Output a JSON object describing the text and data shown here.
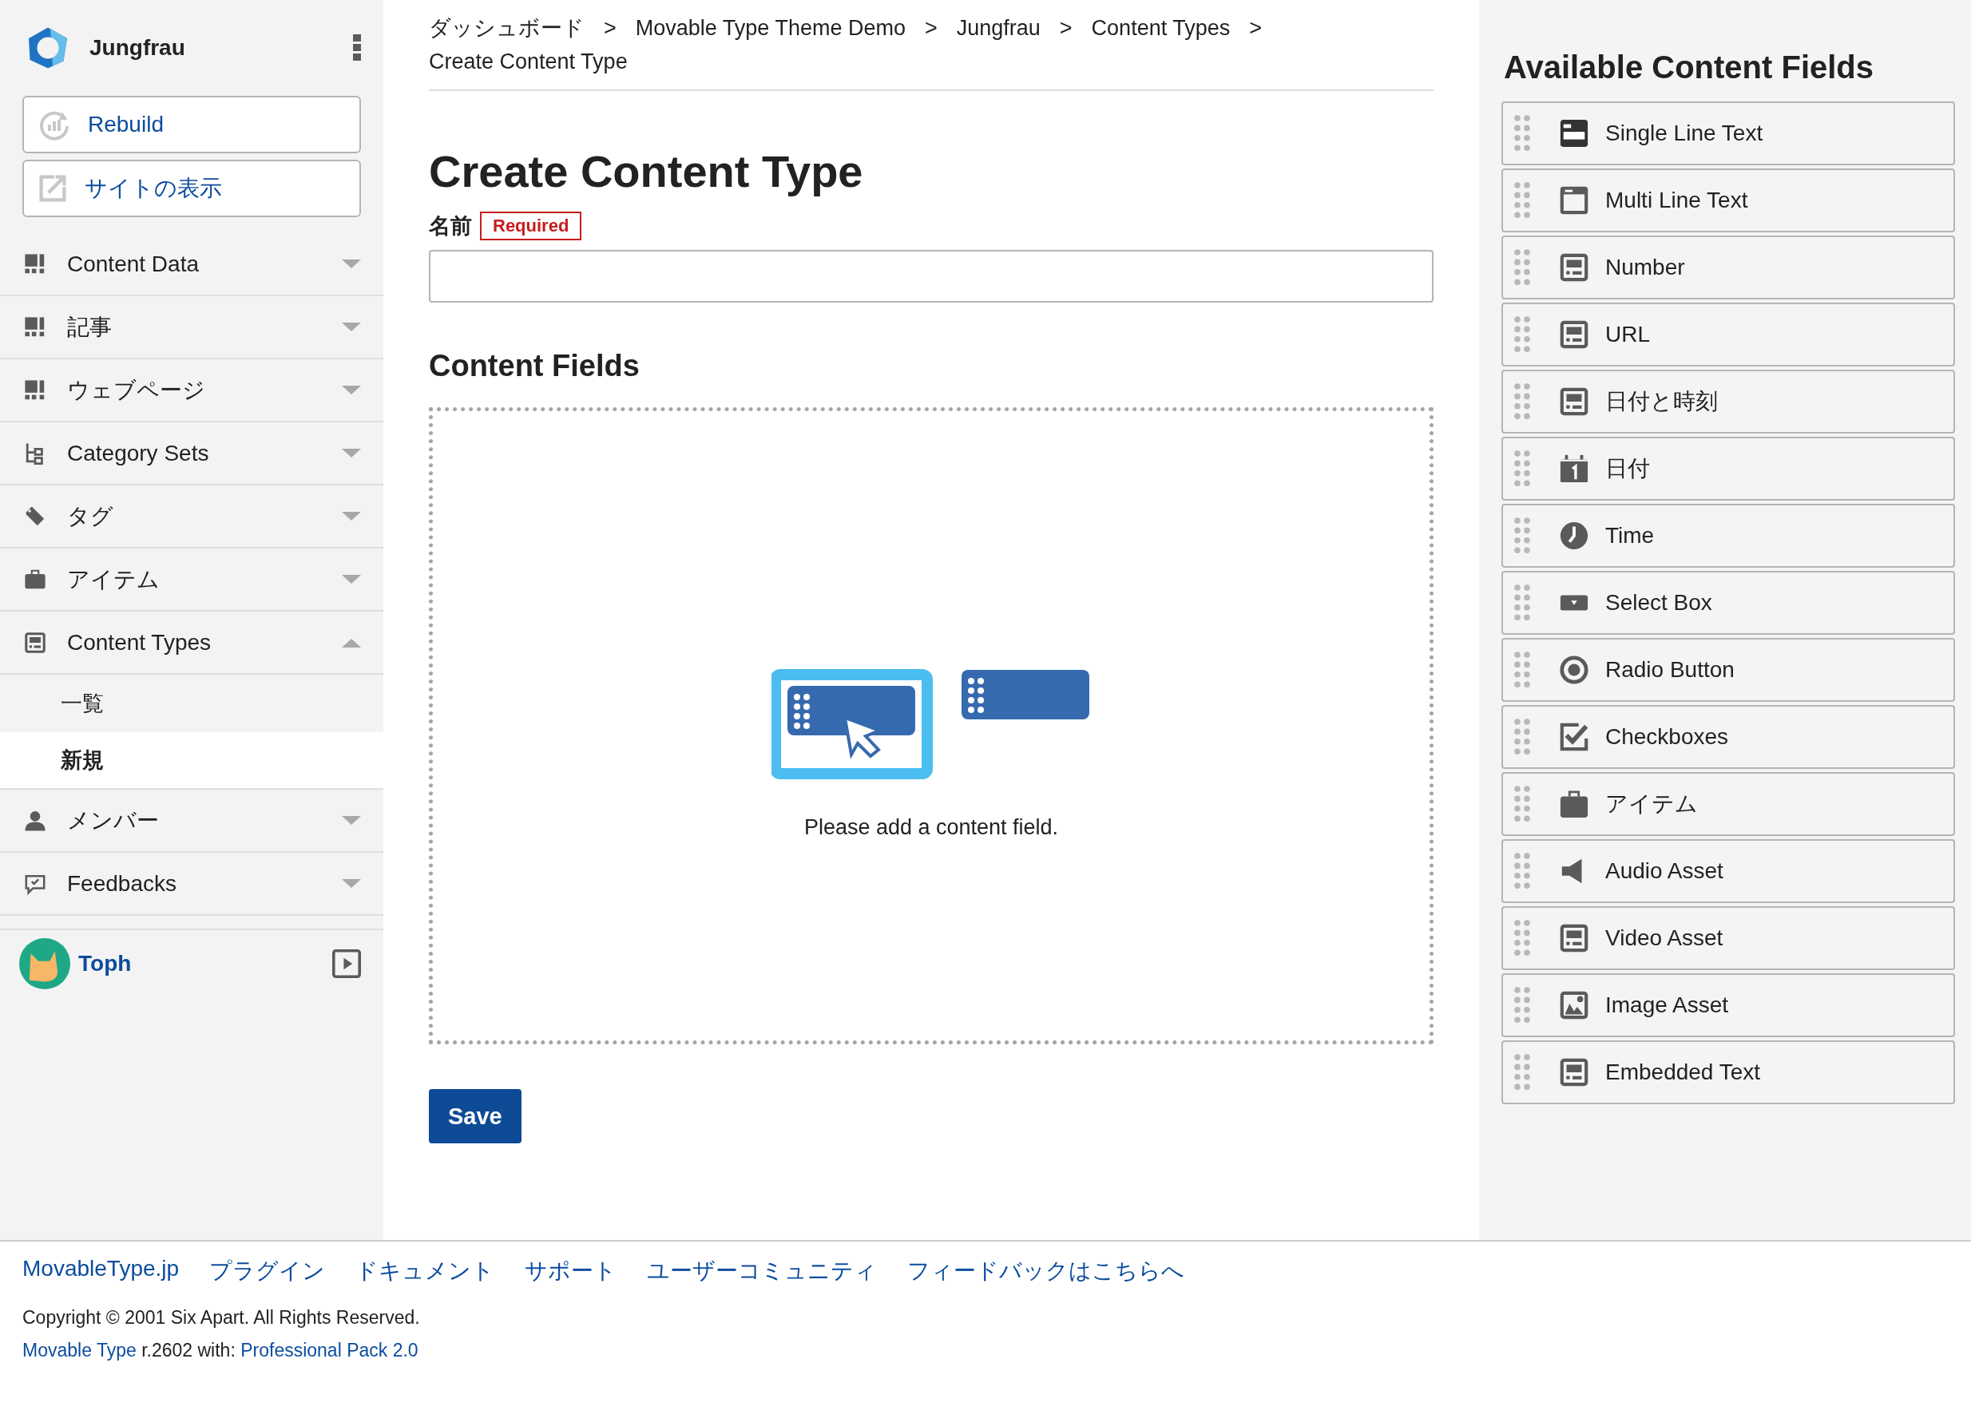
{
  "site": {
    "name": "Jungfrau"
  },
  "actions": [
    {
      "label": "Rebuild",
      "kind": "rebuild"
    },
    {
      "label": "サイトの表示",
      "kind": "view"
    }
  ],
  "nav": [
    {
      "label": "Content Data",
      "kind": "entries",
      "expanded": false
    },
    {
      "label": "記事",
      "kind": "entries",
      "expanded": false
    },
    {
      "label": "ウェブページ",
      "kind": "entries",
      "expanded": false
    },
    {
      "label": "Category Sets",
      "kind": "tree",
      "expanded": false
    },
    {
      "label": "タグ",
      "kind": "tag",
      "expanded": false
    },
    {
      "label": "アイテム",
      "kind": "briefcase",
      "expanded": false
    },
    {
      "label": "Content Types",
      "kind": "form",
      "expanded": true,
      "children": [
        {
          "label": "一覧",
          "selected": false
        },
        {
          "label": "新規",
          "selected": true
        }
      ]
    },
    {
      "label": "メンバー",
      "kind": "person",
      "expanded": false
    },
    {
      "label": "Feedbacks",
      "kind": "feedback",
      "expanded": false
    }
  ],
  "user": {
    "name": "Toph"
  },
  "breadcrumb": {
    "items": [
      "ダッシュボード",
      "Movable Type Theme Demo",
      "Jungfrau",
      "Content Types",
      "Create Content Type"
    ],
    "separators": [
      ">",
      ">",
      ">",
      ">"
    ]
  },
  "form": {
    "title": "Create Content Type",
    "name_field": {
      "label": "名前",
      "badge": "Required"
    },
    "fields_heading": "Content Fields",
    "empty_message": "Please add a content field.",
    "save_button": "Save"
  },
  "available": {
    "title": "Available Content Fields",
    "fields": [
      {
        "label": "Single Line Text",
        "kind": "single-line"
      },
      {
        "label": "Multi Line Text",
        "kind": "multi-line"
      },
      {
        "label": "Number",
        "kind": "form"
      },
      {
        "label": "URL",
        "kind": "form"
      },
      {
        "label": "日付と時刻",
        "kind": "form"
      },
      {
        "label": "日付",
        "kind": "calendar"
      },
      {
        "label": "Time",
        "kind": "clock"
      },
      {
        "label": "Select Box",
        "kind": "select"
      },
      {
        "label": "Radio Button",
        "kind": "radio"
      },
      {
        "label": "Checkboxes",
        "kind": "checkbox"
      },
      {
        "label": "アイテム",
        "kind": "briefcase"
      },
      {
        "label": "Audio Asset",
        "kind": "speaker"
      },
      {
        "label": "Video Asset",
        "kind": "form"
      },
      {
        "label": "Image Asset",
        "kind": "image"
      },
      {
        "label": "Embedded Text",
        "kind": "form"
      }
    ]
  },
  "footer": {
    "links": [
      "MovableType.jp",
      "プラグイン",
      "ドキュメント",
      "サポート",
      "ユーザーコミュニティ",
      "フィードバックはこちらへ"
    ],
    "copyright": "Copyright © 2001 Six Apart. All Rights Reserved.",
    "version": {
      "product": "Movable Type",
      "text": "r.2602 with:",
      "addon": "Professional Pack 2.0"
    }
  }
}
